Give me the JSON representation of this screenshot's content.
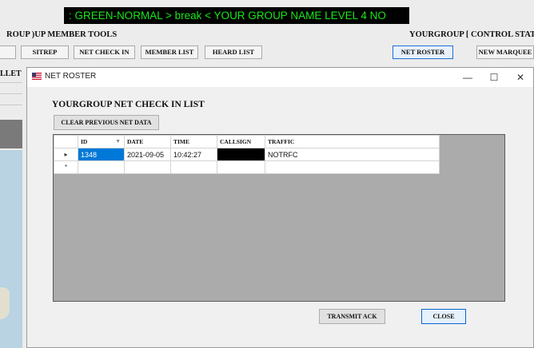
{
  "marquee": {
    "text": ": GREEN-NORMAL  > break <  YOUR GROUP NAME  LEVEL 4 NO"
  },
  "background": {
    "left_heading": "ROUP )UP MEMBER TOOLS",
    "right_heading": "YOURGROUP [ CONTROL STATI",
    "left_label": "LLET",
    "buttons": [
      "",
      "SITREP",
      "NET CHECK IN",
      "MEMBER LIST",
      "HEARD LIST",
      "NET ROSTER",
      "NEW MARQUEE"
    ],
    "selected_button": "NET ROSTER"
  },
  "dialog": {
    "title": "NET ROSTER",
    "controls": {
      "minimize": "—",
      "maximize": "☐",
      "close": "✕"
    },
    "heading": "YOURGROUP NET CHECK IN LIST",
    "clear_button": "CLEAR PREVIOUS NET DATA",
    "transmit_button": "TRANSMIT ACK",
    "close_button": "CLOSE"
  },
  "grid": {
    "columns": [
      "ID",
      "DATE",
      "TIME",
      "CALLSIGN",
      "TRAFFIC"
    ],
    "rows": [
      {
        "marker": "▸",
        "id": "1348",
        "date": "2021-09-05",
        "time": "10:42:27",
        "callsign": "",
        "traffic": "NOTRFC"
      },
      {
        "marker": "*",
        "id": "",
        "date": "",
        "time": "",
        "callsign": "",
        "traffic": ""
      }
    ]
  },
  "colors": {
    "marquee_text": "#19e619",
    "selection": "#0078d7",
    "accent_border": "#0a64d2"
  },
  "icons": {
    "title_icon": "us-flag-icon"
  }
}
